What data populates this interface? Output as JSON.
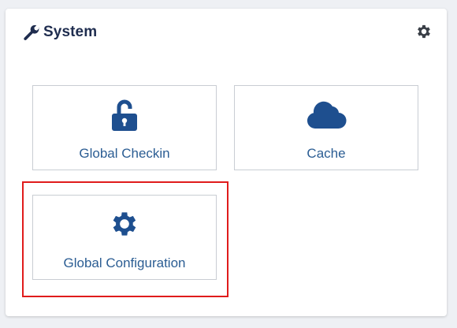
{
  "module": {
    "title": "System",
    "title_icon": "wrench-icon",
    "options_icon": "gear-icon"
  },
  "tiles": [
    {
      "label": "Global Checkin",
      "icon": "unlock-icon"
    },
    {
      "label": "Cache",
      "icon": "cloud-icon"
    },
    {
      "label": "Global Configuration",
      "icon": "gear-icon"
    }
  ],
  "highlighted_tile": "Global Configuration",
  "colors": {
    "icon_blue": "#1e4f8f",
    "label_blue": "#2b5d93",
    "title": "#1f2d4f",
    "highlight": "#e01c1c"
  }
}
